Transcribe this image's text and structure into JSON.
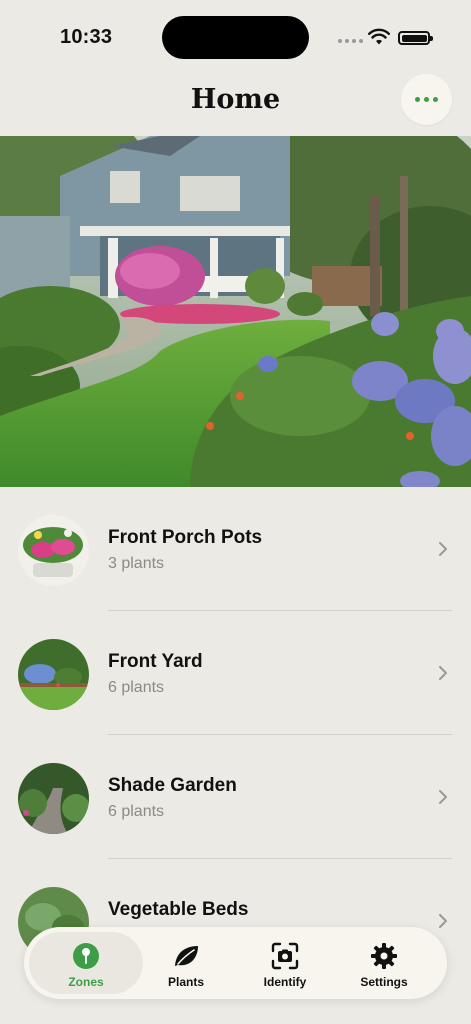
{
  "status_bar": {
    "time": "10:33"
  },
  "header": {
    "title": "Home",
    "more_icon": "ellipsis-icon"
  },
  "hero": {
    "description_icon": "garden-photo"
  },
  "zones": [
    {
      "name": "Front Porch Pots",
      "count": "3 plants"
    },
    {
      "name": "Front Yard",
      "count": "6 plants"
    },
    {
      "name": "Shade Garden",
      "count": "6 plants"
    },
    {
      "name": "Vegetable Beds",
      "count": ""
    }
  ],
  "tab_bar": {
    "tabs": [
      {
        "label": "Zones",
        "icon": "pin-icon",
        "active": true
      },
      {
        "label": "Plants",
        "icon": "leaf-icon",
        "active": false
      },
      {
        "label": "Identify",
        "icon": "camera-icon",
        "active": false
      },
      {
        "label": "Settings",
        "icon": "gear-icon",
        "active": false
      }
    ]
  },
  "colors": {
    "accent": "#3E9E48",
    "background": "#ECEAE4",
    "tab_bar_bg": "#F7F5EE"
  }
}
